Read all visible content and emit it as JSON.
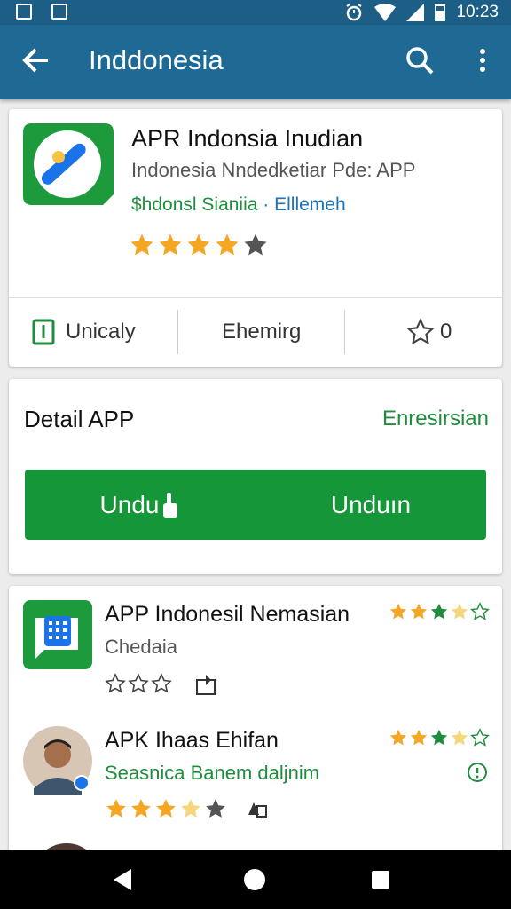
{
  "status_bar": {
    "time": "10:23"
  },
  "app_bar": {
    "title": "Inddonesia"
  },
  "app_header": {
    "name": "APR Indonsia Inudian",
    "subtitle": "Indonesia Nndedketiar Pde: APP",
    "developer": "$hdonsl Sianiia",
    "separator": "·",
    "category": "Elllemeh",
    "rating": 4.5
  },
  "stats": {
    "item1": "Unicaly",
    "item2": "Ehemirg",
    "item3": "0"
  },
  "detail": {
    "title": "Detail APP",
    "link": "Enresirsian",
    "button_left": "Undu",
    "button_right": "Unduın"
  },
  "list": [
    {
      "title": "APP Indonesil Nemasian",
      "subtitle": "Chedaia",
      "rating": 3.5,
      "sub_color": "#555555"
    },
    {
      "title": "APK Ihaas Ehifan",
      "subtitle": "Seasnica Banem daljnim",
      "rating": 3.5,
      "sub_color": "#1e8e3e"
    }
  ],
  "colors": {
    "status_bar": "#1c5e86",
    "app_bar": "#1f6a94",
    "accent_green": "#159638",
    "star": "#f5a623"
  }
}
